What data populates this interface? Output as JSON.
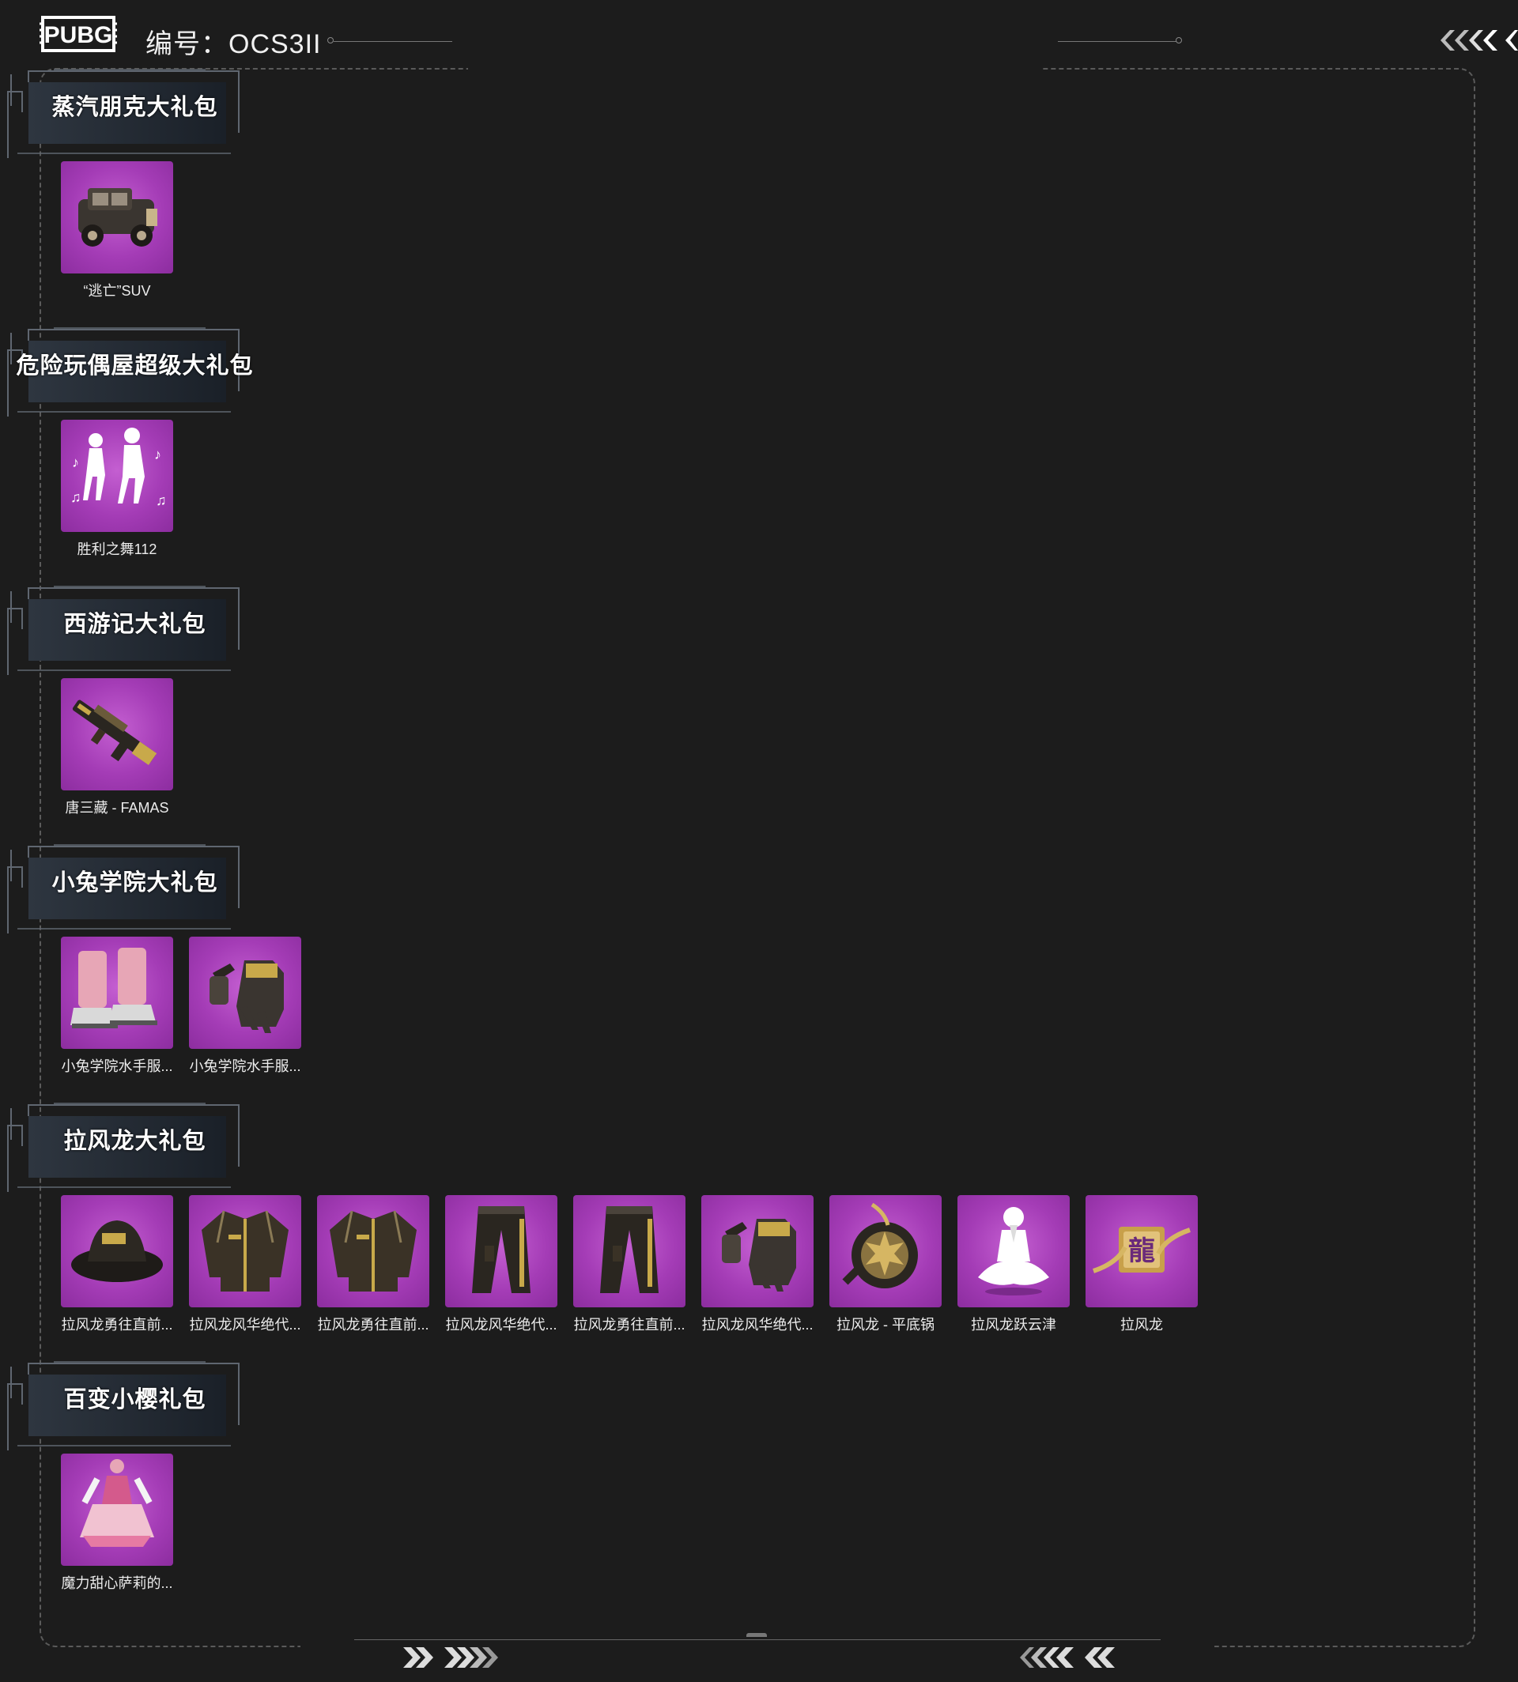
{
  "header": {
    "logo_text": "PUBG",
    "code": "编号：OCS3II"
  },
  "sections": [
    {
      "title": "蒸汽朋克大礼包",
      "items": [
        {
          "label": "“逃亡”SUV",
          "icon": "car-icon"
        }
      ]
    },
    {
      "title": "危险玩偶屋超级大礼包",
      "items": [
        {
          "label": "胜利之舞112",
          "icon": "dance-emote-icon"
        }
      ]
    },
    {
      "title": "西游记大礼包",
      "items": [
        {
          "label": "唐三藏 - FAMAS",
          "icon": "rifle-icon"
        }
      ]
    },
    {
      "title": "小兔学院大礼包",
      "items": [
        {
          "label": "小兔学院水手服...",
          "icon": "boots-icon"
        },
        {
          "label": "小兔学院水手服...",
          "icon": "gloves-icon"
        }
      ]
    },
    {
      "title": "拉风龙大礼包",
      "items": [
        {
          "label": "拉风龙勇往直前...",
          "icon": "hat-icon"
        },
        {
          "label": "拉风龙风华绝代...",
          "icon": "jacket-icon"
        },
        {
          "label": "拉风龙勇往直前...",
          "icon": "jacket-icon"
        },
        {
          "label": "拉风龙风华绝代...",
          "icon": "pants-icon"
        },
        {
          "label": "拉风龙勇往直前...",
          "icon": "pants-icon"
        },
        {
          "label": "拉风龙风华绝代...",
          "icon": "gloves-icon"
        },
        {
          "label": "拉风龙 - 平底锅",
          "icon": "pan-icon"
        },
        {
          "label": "拉风龙跃云津",
          "icon": "meditate-emote-icon"
        },
        {
          "label": "拉风龙",
          "icon": "dragon-emblem-icon"
        }
      ]
    },
    {
      "title": "百变小樱礼包",
      "items": [
        {
          "label": "魔力甜心萨莉的...",
          "icon": "dress-icon"
        }
      ]
    }
  ],
  "colors": {
    "background": "#1c1c1c",
    "item_tile": "#a43cb6",
    "frame": "#5a5a5a"
  }
}
